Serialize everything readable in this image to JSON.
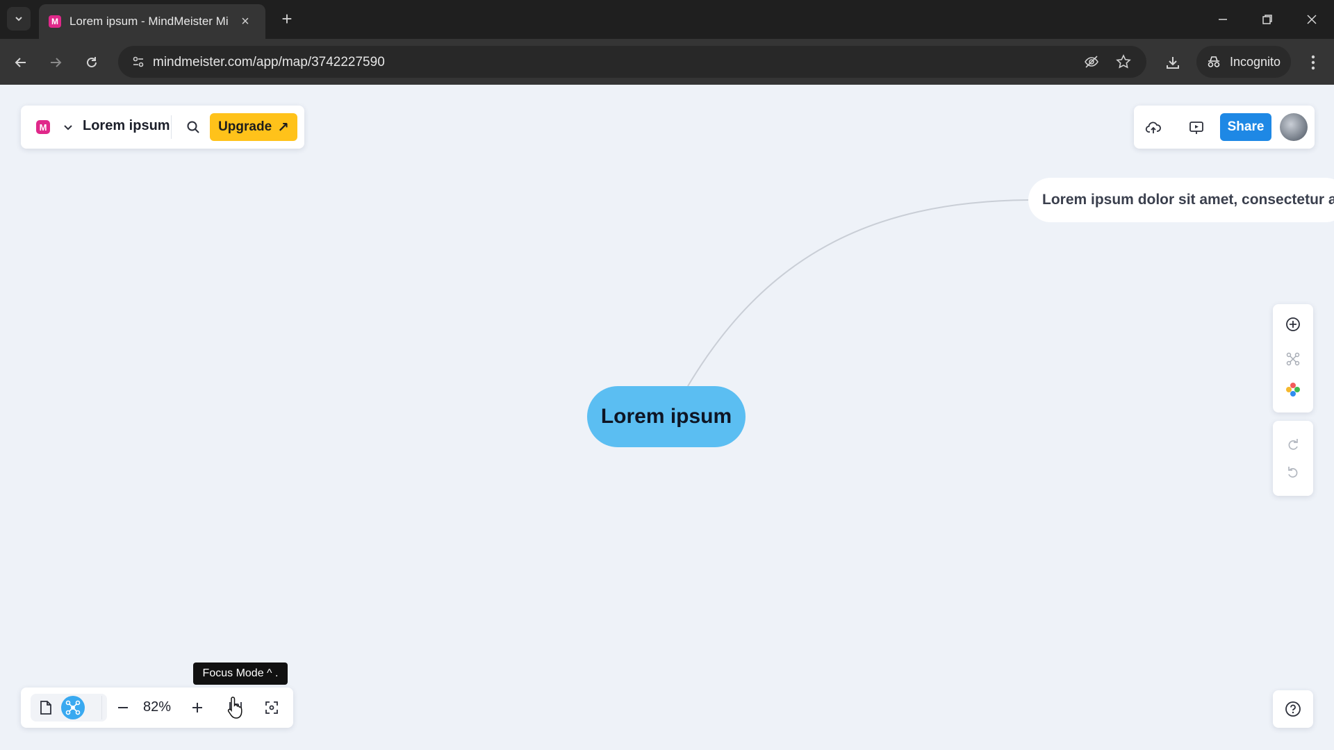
{
  "browser": {
    "tab": {
      "title": "Lorem ipsum - MindMeister Mi",
      "favicon": "M"
    },
    "url": "mindmeister.com/app/map/3742227590",
    "incognito_label": "Incognito"
  },
  "app": {
    "logo": "M",
    "map_title": "Lorem ipsum",
    "upgrade_label": "Upgrade",
    "share_label": "Share",
    "zoom": "82%",
    "tooltip": "Focus Mode ^ .",
    "accent_color": "#1e88e5",
    "upgrade_color": "#ffc21a",
    "root_color": "#5bbef2"
  },
  "map": {
    "root": "Lorem ipsum",
    "child": "Lorem ipsum dolor sit amet, consectetur a"
  }
}
